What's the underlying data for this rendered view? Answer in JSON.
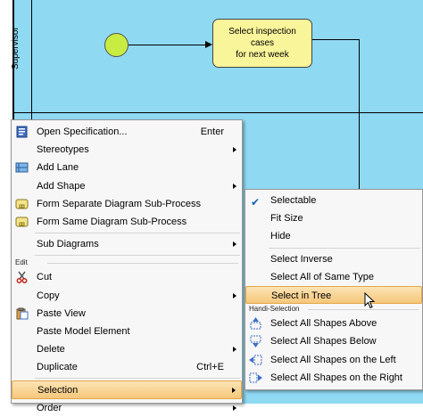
{
  "diagram": {
    "lane_label": "Supervisor",
    "task_label_line1": "Select inspection cases",
    "task_label_line2": "for next week"
  },
  "main_menu": {
    "items": [
      {
        "label": "Open Specification...",
        "shortcut": "Enter",
        "icon": "specification-icon"
      },
      {
        "label": "Stereotypes",
        "submenu": true
      },
      {
        "label": "Add Lane",
        "icon": "lane-icon"
      },
      {
        "label": "Add Shape",
        "submenu": true
      },
      {
        "label": "Form Separate Diagram Sub-Process",
        "icon": "subprocess-icon"
      },
      {
        "label": "Form Same Diagram Sub-Process",
        "icon": "subprocess-icon"
      },
      {
        "label": "Sub Diagrams",
        "submenu": true
      }
    ],
    "edit_header": "Edit",
    "edit_items": [
      {
        "label": "Cut",
        "icon": "scissors-icon"
      },
      {
        "label": "Copy",
        "submenu": true
      },
      {
        "label": "Paste View",
        "icon": "clipboard-icon"
      },
      {
        "label": "Paste Model Element"
      },
      {
        "label": "Delete",
        "submenu": true
      },
      {
        "label": "Duplicate",
        "shortcut": "Ctrl+E"
      },
      {
        "label": "Selection",
        "submenu": true,
        "highlighted": true
      },
      {
        "label": "Order",
        "submenu": true
      }
    ]
  },
  "selection_menu": {
    "items": [
      {
        "label": "Selectable",
        "checked": true
      },
      {
        "label": "Fit Size"
      },
      {
        "label": "Hide"
      },
      {
        "label": "Select Inverse"
      },
      {
        "label": "Select All of Same Type"
      },
      {
        "label": "Select in Tree",
        "highlighted": true
      }
    ],
    "handy_header": "Handi-Selection",
    "handy_items": [
      {
        "label": "Select All Shapes Above",
        "icon": "select-above-icon"
      },
      {
        "label": "Select All Shapes Below",
        "icon": "select-below-icon"
      },
      {
        "label": "Select All Shapes on the Left",
        "icon": "select-left-icon"
      },
      {
        "label": "Select All Shapes on the Right",
        "icon": "select-right-icon"
      }
    ]
  },
  "colors": {
    "pool_background": "#8fd9f3",
    "task_fill": "#f9f59a",
    "start_event_fill": "#c8ec42",
    "menu_highlight": "#f6c77a"
  }
}
